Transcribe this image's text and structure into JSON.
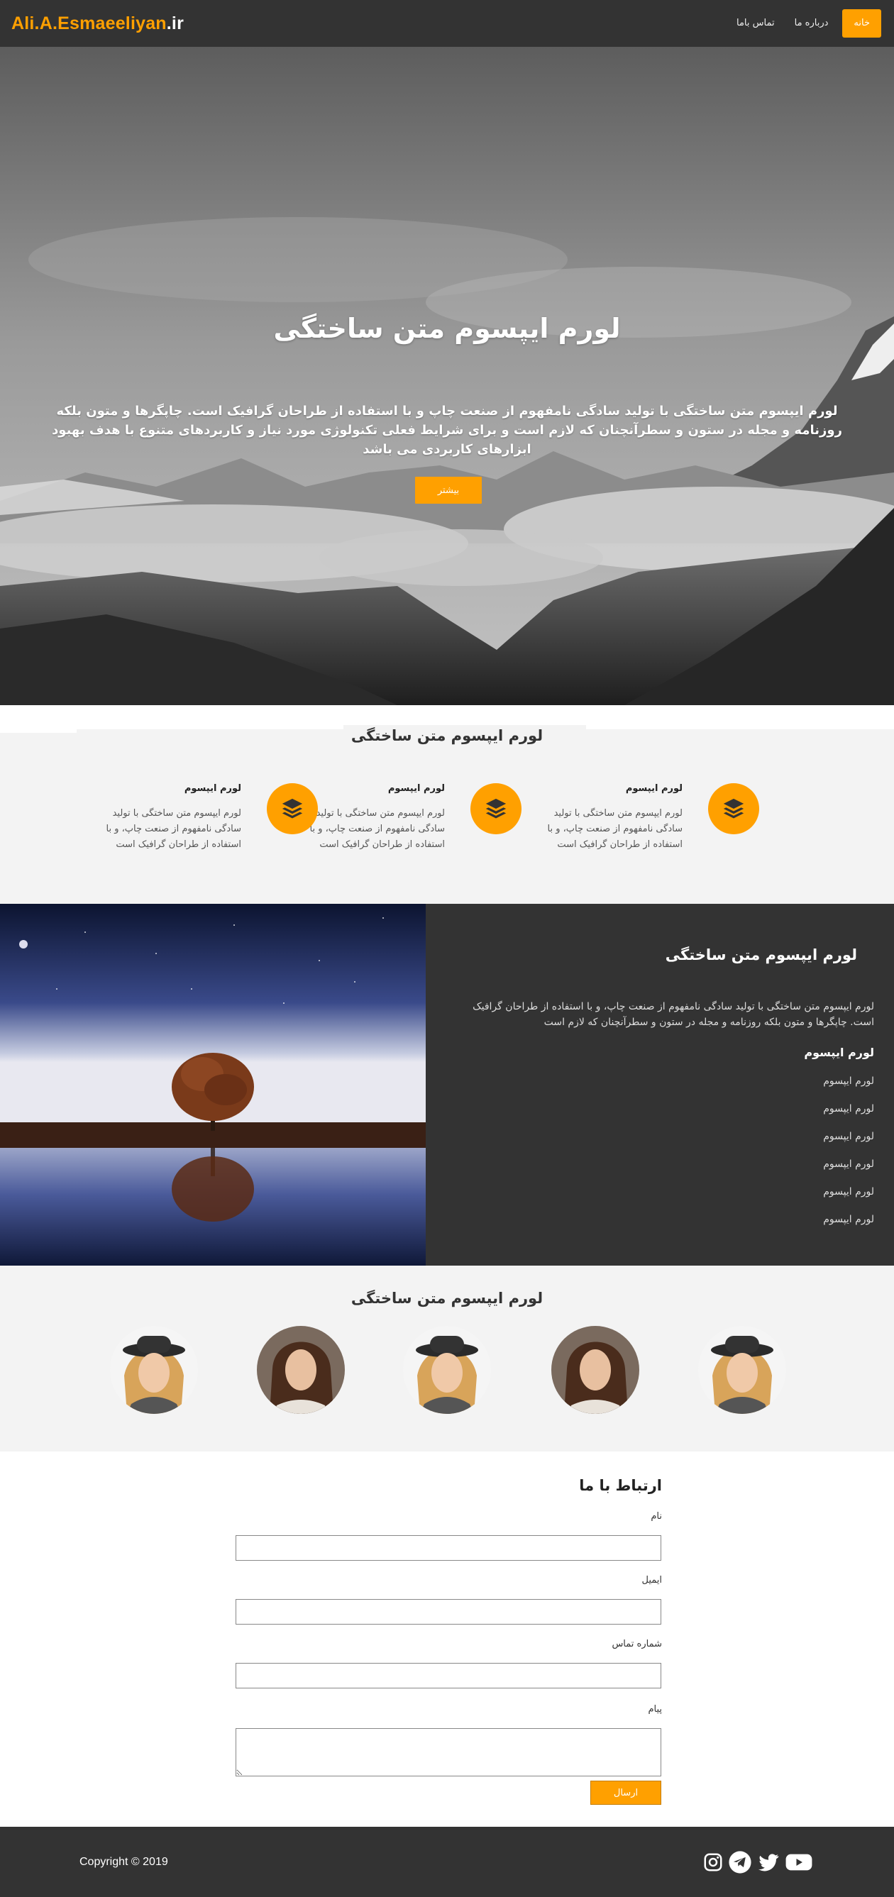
{
  "nav": {
    "brand_main": "Ali.A.Esmaeeliyan",
    "brand_tld": ".ir",
    "items": [
      {
        "label": "خانه",
        "active": true
      },
      {
        "label": "درباره ما",
        "active": false
      },
      {
        "label": "تماس باما",
        "active": false
      }
    ]
  },
  "hero": {
    "title": "لورم ایپسوم متن ساختگی",
    "text": "لورم ایپسوم متن ساختگی با تولید سادگی نامفهوم از صنعت چاپ و با استفاده از طراحان گرافیک است. چاپگرها و متون بلکه روزنامه و مجله در ستون و سطرآنچنان که لازم است و برای شرایط فعلی تکنولوژی مورد نیاز و کاربردهای متنوع با هدف بهبود ابزارهای کاربردی می باشد",
    "button": "بیشتر"
  },
  "features": {
    "title": "لورم ایپسوم متن ساختگی",
    "items": [
      {
        "title": "لورم ایپسوم",
        "text": "لورم ایپسوم متن ساختگی با تولید سادگی نامفهوم از صنعت چاپ، و با استفاده از طراحان گرافیک است",
        "icon": "layers-icon"
      },
      {
        "title": "لورم ایپسوم",
        "text": "لورم ایپسوم متن ساختگی با تولید سادگی نامفهوم از صنعت چاپ، و با استفاده از طراحان گرافیک است",
        "icon": "layers-icon"
      },
      {
        "title": "لورم ایپسوم",
        "text": "لورم ایپسوم متن ساختگی با تولید سادگی نامفهوم از صنعت چاپ، و با استفاده از طراحان گرافیک است",
        "icon": "layers-icon"
      }
    ]
  },
  "about": {
    "title": "لورم ایپسوم متن ساختگی",
    "text": "لورم ایپسوم متن ساختگی با تولید سادگی نامفهوم از صنعت چاپ، و با استفاده از طراحان گرافیک است. چاپگرها و متون بلکه روزنامه و مجله در ستون و سطرآنچنان که لازم است",
    "subtitle": "لورم ایپسوم",
    "list": [
      "لورم ایپسوم",
      "لورم ایپسوم",
      "لورم ایپسوم",
      "لورم ایپسوم",
      "لورم ایپسوم",
      "لورم ایپسوم"
    ]
  },
  "team": {
    "title": "لورم ایپسوم متن ساختگی"
  },
  "contact": {
    "title": "ارتباط با ما",
    "name_label": "نام",
    "email_label": "ایمیل",
    "phone_label": "شماره تماس",
    "message_label": "پیام",
    "submit": "ارسال"
  },
  "footer": {
    "copyright": "Copyright © 2019",
    "socials": [
      "instagram-icon",
      "telegram-icon",
      "twitter-icon",
      "youtube-icon"
    ]
  },
  "colors": {
    "accent": "#ffa000",
    "dark": "#333333",
    "light": "#f3f3f3"
  }
}
